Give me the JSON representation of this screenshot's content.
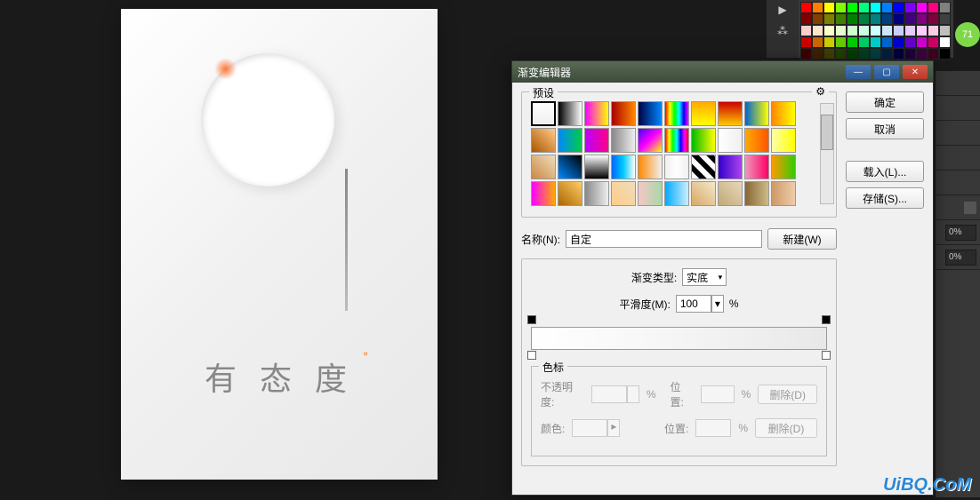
{
  "canvas": {
    "tagline": "有 态 度",
    "accent": "°"
  },
  "swatches": {
    "badge": "71",
    "colors": [
      "#ff0000",
      "#ff8000",
      "#ffff00",
      "#80ff00",
      "#00ff00",
      "#00ff80",
      "#00ffff",
      "#0080ff",
      "#0000ff",
      "#8000ff",
      "#ff00ff",
      "#ff0080",
      "#808080",
      "#800000",
      "#804000",
      "#808000",
      "#408000",
      "#008000",
      "#008040",
      "#008080",
      "#004080",
      "#000080",
      "#400080",
      "#800080",
      "#800040",
      "#404040",
      "#ffcccc",
      "#ffe5cc",
      "#ffffcc",
      "#e5ffcc",
      "#ccffcc",
      "#ccffe5",
      "#ccffff",
      "#cce5ff",
      "#ccccff",
      "#e5ccff",
      "#ffccff",
      "#ffcce5",
      "#c0c0c0",
      "#cc0000",
      "#cc6600",
      "#cccc00",
      "#66cc00",
      "#00cc00",
      "#00cc66",
      "#00cccc",
      "#0066cc",
      "#0000cc",
      "#6600cc",
      "#cc00cc",
      "#cc0066",
      "#ffffff",
      "#400000",
      "#402000",
      "#404000",
      "#204000",
      "#004000",
      "#004020",
      "#004040",
      "#002040",
      "#000040",
      "#200040",
      "#400040",
      "#400020",
      "#000000"
    ]
  },
  "panels": {
    "opacity1": "0%",
    "opacity2": "0%"
  },
  "dialog": {
    "title": "渐变编辑器",
    "presets_label": "预设",
    "gear": "⚙",
    "buttons": {
      "ok": "确定",
      "cancel": "取消",
      "load": "载入(L)...",
      "save": "存储(S)...",
      "new": "新建(W)"
    },
    "name_label": "名称(N):",
    "name_value": "自定",
    "type_label": "渐变类型:",
    "type_value": "实底",
    "smoothness_label": "平滑度(M):",
    "smoothness_value": "100",
    "percent": "%",
    "stops_label": "色标",
    "opacity_label": "不透明度:",
    "position_label": "位置:",
    "color_label": "颜色:",
    "delete_label": "删除(D)"
  },
  "presets": [
    "linear-gradient(180deg,#fff,#eee)",
    "linear-gradient(90deg,#000,#fff)",
    "linear-gradient(90deg,#f0f,#ff0)",
    "linear-gradient(90deg,#a00,#f80)",
    "linear-gradient(90deg,#004,#08f)",
    "linear-gradient(90deg,#f00,#ff0,#0f0,#0ff,#00f,#f0f)",
    "linear-gradient(180deg,#fa0,#ff0)",
    "linear-gradient(180deg,#c00,#fc0)",
    "linear-gradient(90deg,#06c,#ff0)",
    "linear-gradient(90deg,#f80,#ff0)",
    "linear-gradient(45deg,#a50,#fc8)",
    "linear-gradient(90deg,#08f,#0c4)",
    "linear-gradient(90deg,#b0f,#f08)",
    "linear-gradient(90deg,#888,#eee)",
    "linear-gradient(135deg,#40f,#f0f,#ff0)",
    "linear-gradient(90deg,#f00,#ff0,#0f0,#0ff,#00f,#f0f,#f00)",
    "linear-gradient(90deg,#0b0,#ff0)",
    "linear-gradient(90deg,#fff,transparent)",
    "linear-gradient(90deg,#fa0,#f50)",
    "linear-gradient(90deg,#ffa,#ff0)",
    "linear-gradient(45deg,#c84,#edb)",
    "linear-gradient(45deg,#08f,#000)",
    "linear-gradient(180deg,#fff,#000)",
    "linear-gradient(90deg,#06f,#0cf,#fff)",
    "linear-gradient(90deg,#f80,transparent)",
    "linear-gradient(90deg,transparent,#fff,transparent)",
    "repeating-linear-gradient(45deg,#fff 0 6px,#000 6px 12px)",
    "linear-gradient(90deg,#30c,#a4e)",
    "linear-gradient(90deg,#e9b,#f06)",
    "linear-gradient(90deg,#f90,#3c0)",
    "linear-gradient(90deg,#f0f,#fa0)",
    "linear-gradient(45deg,#a60,#fc6)",
    "linear-gradient(90deg,#888,#eee)",
    "linear-gradient(45deg,#fc8,#edb)",
    "linear-gradient(90deg,#f5c7c7,#a8d8a8)",
    "linear-gradient(90deg,#0af,#cef)",
    "linear-gradient(45deg,#d8a868,#f5e8c8)",
    "linear-gradient(45deg,#c0a878,#e8d8b8)",
    "linear-gradient(90deg,#863,#cb8)",
    "linear-gradient(90deg,#c96,#eca)"
  ],
  "watermark": "UiBQ.CoM"
}
